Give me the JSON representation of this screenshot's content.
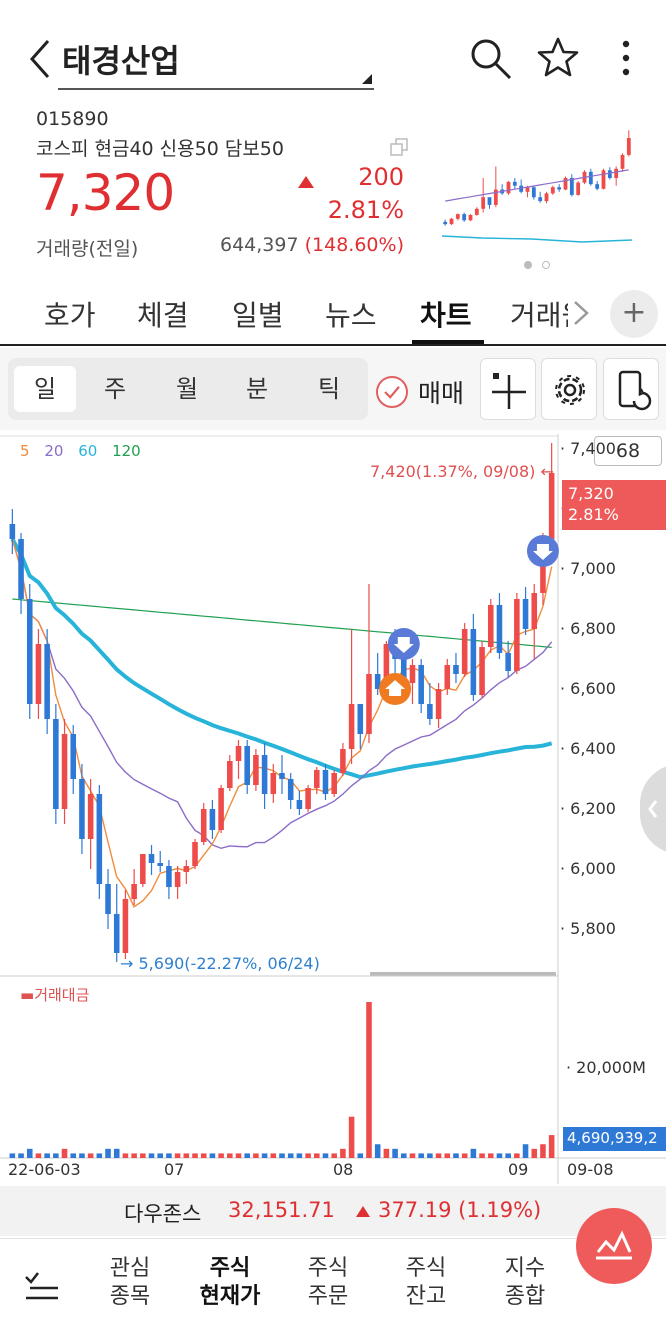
{
  "header": {
    "title": "태경산업"
  },
  "quote": {
    "code": "015890",
    "margin_info": "코스피 현금40 신용50 담보50",
    "price": "7,320",
    "change": "200",
    "change_pct": "2.81%",
    "volume_label": "거래량(전일)",
    "volume_value": "644,397",
    "volume_pct": "(148.60%)"
  },
  "tabs": [
    {
      "label": "호가"
    },
    {
      "label": "체결"
    },
    {
      "label": "일별"
    },
    {
      "label": "뉴스"
    },
    {
      "label": "차트",
      "active": true
    },
    {
      "label": "거래원"
    }
  ],
  "periods": [
    {
      "label": "일",
      "active": true
    },
    {
      "label": "주"
    },
    {
      "label": "월"
    },
    {
      "label": "분"
    },
    {
      "label": "틱"
    }
  ],
  "trade_toggle": "매매",
  "chart_header": {
    "ma": [
      {
        "label": "5",
        "color": "#f08c3c"
      },
      {
        "label": "20",
        "color": "#8c6cc8"
      },
      {
        "label": "60",
        "color": "#28b4d8"
      },
      {
        "label": "120",
        "color": "#20a050"
      }
    ],
    "count": "68"
  },
  "chart_data": {
    "type": "candlestick",
    "y_ticks": [
      "7,400",
      "7,200",
      "7,000",
      "6,800",
      "6,600",
      "6,400",
      "6,200",
      "6,000",
      "5,800"
    ],
    "ylim": [
      5650,
      7450
    ],
    "high_annotation": "7,420(1.37%, 09/08)",
    "low_annotation": "5,690(-22.27%, 06/24)",
    "current_price": "7,320",
    "current_pct": "2.81%",
    "x_labels": [
      "22-06-03",
      "07",
      "08",
      "09",
      "09-08"
    ],
    "volume_label": "거래대금",
    "volume_tick": "20,000M",
    "volume_current": "4,690,939,2",
    "candles": [
      [
        7150,
        7200,
        7050,
        7100
      ],
      [
        7100,
        7120,
        6850,
        6900
      ],
      [
        6900,
        6950,
        6500,
        6550
      ],
      [
        6550,
        6800,
        6500,
        6750
      ],
      [
        6750,
        6800,
        6450,
        6500
      ],
      [
        6500,
        6550,
        6150,
        6200
      ],
      [
        6200,
        6500,
        6150,
        6450
      ],
      [
        6450,
        6480,
        6250,
        6300
      ],
      [
        6300,
        6350,
        6050,
        6100
      ],
      [
        6100,
        6300,
        6000,
        6250
      ],
      [
        6250,
        6280,
        5900,
        5950
      ],
      [
        5950,
        6000,
        5800,
        5850
      ],
      [
        5850,
        5950,
        5690,
        5720
      ],
      [
        5720,
        5930,
        5700,
        5900
      ],
      [
        5900,
        6000,
        5880,
        5950
      ],
      [
        5950,
        6050,
        5940,
        6050
      ],
      [
        6050,
        6080,
        5980,
        6020
      ],
      [
        6020,
        6060,
        5990,
        6010
      ],
      [
        6010,
        6030,
        5900,
        5940
      ],
      [
        5940,
        6010,
        5900,
        5990
      ],
      [
        5990,
        6030,
        5950,
        6010
      ],
      [
        6010,
        6100,
        6000,
        6090
      ],
      [
        6090,
        6220,
        6080,
        6200
      ],
      [
        6200,
        6230,
        6100,
        6130
      ],
      [
        6130,
        6280,
        6120,
        6270
      ],
      [
        6270,
        6380,
        6260,
        6360
      ],
      [
        6360,
        6430,
        6300,
        6410
      ],
      [
        6410,
        6430,
        6250,
        6280
      ],
      [
        6280,
        6400,
        6260,
        6380
      ],
      [
        6380,
        6420,
        6200,
        6250
      ],
      [
        6250,
        6350,
        6220,
        6320
      ],
      [
        6320,
        6380,
        6250,
        6300
      ],
      [
        6300,
        6320,
        6200,
        6230
      ],
      [
        6230,
        6260,
        6180,
        6200
      ],
      [
        6200,
        6280,
        6190,
        6270
      ],
      [
        6270,
        6340,
        6250,
        6330
      ],
      [
        6330,
        6350,
        6230,
        6250
      ],
      [
        6250,
        6330,
        6240,
        6320
      ],
      [
        6320,
        6420,
        6310,
        6400
      ],
      [
        6400,
        6800,
        6350,
        6550
      ],
      [
        6550,
        6550,
        6400,
        6450
      ],
      [
        6450,
        6950,
        6420,
        6650
      ],
      [
        6650,
        6720,
        6580,
        6600
      ],
      [
        6600,
        6760,
        6580,
        6750
      ],
      [
        6750,
        6800,
        6650,
        6700
      ],
      [
        6700,
        6780,
        6600,
        6620
      ],
      [
        6620,
        6700,
        6550,
        6680
      ],
      [
        6680,
        6700,
        6520,
        6550
      ],
      [
        6550,
        6620,
        6480,
        6500
      ],
      [
        6500,
        6620,
        6470,
        6600
      ],
      [
        6600,
        6700,
        6580,
        6680
      ],
      [
        6680,
        6720,
        6620,
        6650
      ],
      [
        6650,
        6820,
        6640,
        6800
      ],
      [
        6800,
        6850,
        6560,
        6580
      ],
      [
        6580,
        6760,
        6570,
        6740
      ],
      [
        6740,
        6900,
        6720,
        6880
      ],
      [
        6880,
        6920,
        6700,
        6720
      ],
      [
        6720,
        6760,
        6640,
        6660
      ],
      [
        6660,
        6920,
        6650,
        6900
      ],
      [
        6900,
        6940,
        6780,
        6800
      ],
      [
        6800,
        6950,
        6700,
        6920
      ],
      [
        6920,
        7120,
        6880,
        7100
      ],
      [
        7100,
        7420,
        7080,
        7320
      ]
    ],
    "volumes": [
      1,
      1,
      2,
      1,
      1,
      1,
      2,
      1,
      1,
      1,
      1,
      2,
      2,
      1,
      1,
      1,
      1,
      1,
      1,
      1,
      1,
      1,
      1,
      1,
      1,
      1,
      1,
      1,
      1,
      1,
      1,
      1,
      1,
      1,
      1,
      1,
      1,
      1,
      2,
      9,
      1,
      34,
      3,
      2,
      2,
      1,
      1,
      1,
      1,
      1,
      1,
      1,
      1,
      2,
      1,
      1,
      1,
      1,
      1,
      3,
      2,
      3,
      5
    ]
  },
  "market_index": {
    "name": "다우존스",
    "value": "32,151.71",
    "change": "377.19 (1.19%)"
  },
  "bottom_nav": [
    {
      "label": "관심\n종목"
    },
    {
      "label": "주식\n현재가",
      "active": true
    },
    {
      "label": "주식\n주문"
    },
    {
      "label": "주식\n잔고"
    },
    {
      "label": "지수\n종합"
    }
  ]
}
